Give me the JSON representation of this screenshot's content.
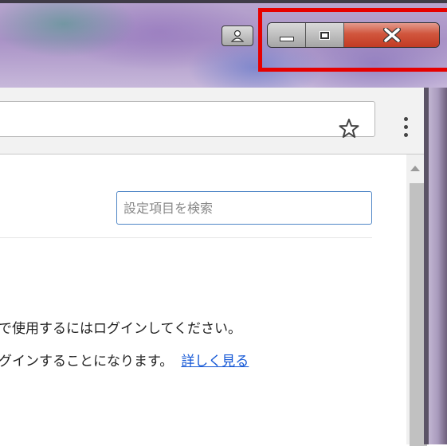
{
  "window": {
    "caption_buttons": [
      "minimize",
      "maximize",
      "close"
    ],
    "close_color": "#c8452e",
    "highlight_color": "#e60000"
  },
  "toolbar": {
    "bookmark_icon": "star-icon",
    "menu_icon": "vertical-dots-icon"
  },
  "settings": {
    "search_placeholder": "設定項目を検索",
    "signin_text_line1": "で使用するにはログインしてください。",
    "signin_text_line2": "グインすることになります。",
    "learn_more_link": "詳しく見る",
    "link_color": "#1558d6"
  }
}
